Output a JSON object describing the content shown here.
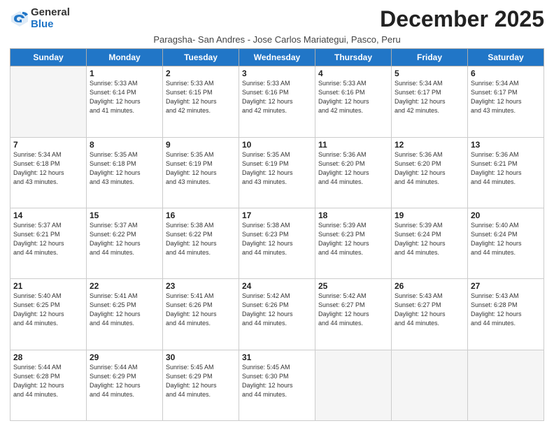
{
  "logo": {
    "general": "General",
    "blue": "Blue"
  },
  "header": {
    "month": "December 2025",
    "subtitle": "Paragsha- San Andres - Jose Carlos Mariategui, Pasco, Peru"
  },
  "weekdays": [
    "Sunday",
    "Monday",
    "Tuesday",
    "Wednesday",
    "Thursday",
    "Friday",
    "Saturday"
  ],
  "weeks": [
    [
      {
        "day": "",
        "info": ""
      },
      {
        "day": "1",
        "info": "Sunrise: 5:33 AM\nSunset: 6:14 PM\nDaylight: 12 hours\nand 41 minutes."
      },
      {
        "day": "2",
        "info": "Sunrise: 5:33 AM\nSunset: 6:15 PM\nDaylight: 12 hours\nand 42 minutes."
      },
      {
        "day": "3",
        "info": "Sunrise: 5:33 AM\nSunset: 6:16 PM\nDaylight: 12 hours\nand 42 minutes."
      },
      {
        "day": "4",
        "info": "Sunrise: 5:33 AM\nSunset: 6:16 PM\nDaylight: 12 hours\nand 42 minutes."
      },
      {
        "day": "5",
        "info": "Sunrise: 5:34 AM\nSunset: 6:17 PM\nDaylight: 12 hours\nand 42 minutes."
      },
      {
        "day": "6",
        "info": "Sunrise: 5:34 AM\nSunset: 6:17 PM\nDaylight: 12 hours\nand 43 minutes."
      }
    ],
    [
      {
        "day": "7",
        "info": "Sunrise: 5:34 AM\nSunset: 6:18 PM\nDaylight: 12 hours\nand 43 minutes."
      },
      {
        "day": "8",
        "info": "Sunrise: 5:35 AM\nSunset: 6:18 PM\nDaylight: 12 hours\nand 43 minutes."
      },
      {
        "day": "9",
        "info": "Sunrise: 5:35 AM\nSunset: 6:19 PM\nDaylight: 12 hours\nand 43 minutes."
      },
      {
        "day": "10",
        "info": "Sunrise: 5:35 AM\nSunset: 6:19 PM\nDaylight: 12 hours\nand 43 minutes."
      },
      {
        "day": "11",
        "info": "Sunrise: 5:36 AM\nSunset: 6:20 PM\nDaylight: 12 hours\nand 44 minutes."
      },
      {
        "day": "12",
        "info": "Sunrise: 5:36 AM\nSunset: 6:20 PM\nDaylight: 12 hours\nand 44 minutes."
      },
      {
        "day": "13",
        "info": "Sunrise: 5:36 AM\nSunset: 6:21 PM\nDaylight: 12 hours\nand 44 minutes."
      }
    ],
    [
      {
        "day": "14",
        "info": "Sunrise: 5:37 AM\nSunset: 6:21 PM\nDaylight: 12 hours\nand 44 minutes."
      },
      {
        "day": "15",
        "info": "Sunrise: 5:37 AM\nSunset: 6:22 PM\nDaylight: 12 hours\nand 44 minutes."
      },
      {
        "day": "16",
        "info": "Sunrise: 5:38 AM\nSunset: 6:22 PM\nDaylight: 12 hours\nand 44 minutes."
      },
      {
        "day": "17",
        "info": "Sunrise: 5:38 AM\nSunset: 6:23 PM\nDaylight: 12 hours\nand 44 minutes."
      },
      {
        "day": "18",
        "info": "Sunrise: 5:39 AM\nSunset: 6:23 PM\nDaylight: 12 hours\nand 44 minutes."
      },
      {
        "day": "19",
        "info": "Sunrise: 5:39 AM\nSunset: 6:24 PM\nDaylight: 12 hours\nand 44 minutes."
      },
      {
        "day": "20",
        "info": "Sunrise: 5:40 AM\nSunset: 6:24 PM\nDaylight: 12 hours\nand 44 minutes."
      }
    ],
    [
      {
        "day": "21",
        "info": "Sunrise: 5:40 AM\nSunset: 6:25 PM\nDaylight: 12 hours\nand 44 minutes."
      },
      {
        "day": "22",
        "info": "Sunrise: 5:41 AM\nSunset: 6:25 PM\nDaylight: 12 hours\nand 44 minutes."
      },
      {
        "day": "23",
        "info": "Sunrise: 5:41 AM\nSunset: 6:26 PM\nDaylight: 12 hours\nand 44 minutes."
      },
      {
        "day": "24",
        "info": "Sunrise: 5:42 AM\nSunset: 6:26 PM\nDaylight: 12 hours\nand 44 minutes."
      },
      {
        "day": "25",
        "info": "Sunrise: 5:42 AM\nSunset: 6:27 PM\nDaylight: 12 hours\nand 44 minutes."
      },
      {
        "day": "26",
        "info": "Sunrise: 5:43 AM\nSunset: 6:27 PM\nDaylight: 12 hours\nand 44 minutes."
      },
      {
        "day": "27",
        "info": "Sunrise: 5:43 AM\nSunset: 6:28 PM\nDaylight: 12 hours\nand 44 minutes."
      }
    ],
    [
      {
        "day": "28",
        "info": "Sunrise: 5:44 AM\nSunset: 6:28 PM\nDaylight: 12 hours\nand 44 minutes."
      },
      {
        "day": "29",
        "info": "Sunrise: 5:44 AM\nSunset: 6:29 PM\nDaylight: 12 hours\nand 44 minutes."
      },
      {
        "day": "30",
        "info": "Sunrise: 5:45 AM\nSunset: 6:29 PM\nDaylight: 12 hours\nand 44 minutes."
      },
      {
        "day": "31",
        "info": "Sunrise: 5:45 AM\nSunset: 6:30 PM\nDaylight: 12 hours\nand 44 minutes."
      },
      {
        "day": "",
        "info": ""
      },
      {
        "day": "",
        "info": ""
      },
      {
        "day": "",
        "info": ""
      }
    ]
  ]
}
